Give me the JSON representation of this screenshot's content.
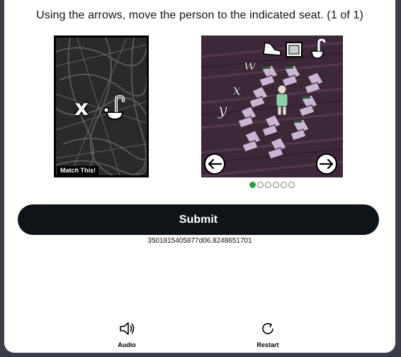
{
  "instruction": "Using the arrows, move the person to the indicated seat. (1 of 1)",
  "target_card": {
    "symbols": [
      "x",
      "toilet-icon"
    ],
    "label": "Match This!"
  },
  "game_view": {
    "row_letters": [
      "w",
      "x",
      "y"
    ],
    "top_icons": [
      "shoe-icon",
      "picture-frame-icon",
      "toilet-icon"
    ],
    "left_arrow": "left-arrow-icon",
    "right_arrow": "right-arrow-icon"
  },
  "pagination": {
    "total": 6,
    "active": 1
  },
  "submit_label": "Submit",
  "session_id": "3501815405877d06.8248651701",
  "footer": {
    "audio_label": "Audio",
    "restart_label": "Restart"
  }
}
